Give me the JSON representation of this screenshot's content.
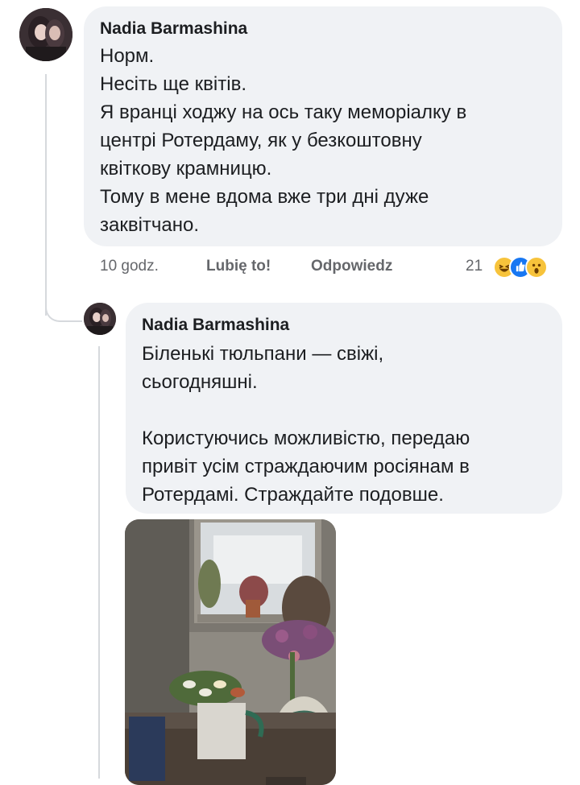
{
  "comment": {
    "author": "Nadia Barmashina",
    "lines": [
      "Норм.",
      "Несіть ще квітів.",
      "Я вранці ходжу на ось таку меморіалку в",
      "центрі Ротердаму, як у безкоштовну",
      "квіткову крамницю.",
      "Тому в мене вдома вже три дні дуже",
      "заквітчано."
    ],
    "time": "10 godz.",
    "like_label": "Lubię to!",
    "reply_label": "Odpowiedz",
    "reaction_count": "21",
    "reaction_icons": [
      "haha-reaction-icon",
      "like-reaction-icon",
      "wow-reaction-icon"
    ]
  },
  "reply": {
    "author": "Nadia Barmashina",
    "lines": [
      "Біленькі тюльпани — свіжі,",
      "сьогодняшні.",
      "",
      "Користуючись можливістю, передаю",
      "привіт усім страждаючим росіянам в",
      "Ротердамі. Страждайте подовше."
    ]
  },
  "colors": {
    "bubble": "#f0f2f5",
    "meta_text": "#65676b",
    "like_blue": "#1877f2",
    "haha_yellow": "#f7c33b"
  }
}
